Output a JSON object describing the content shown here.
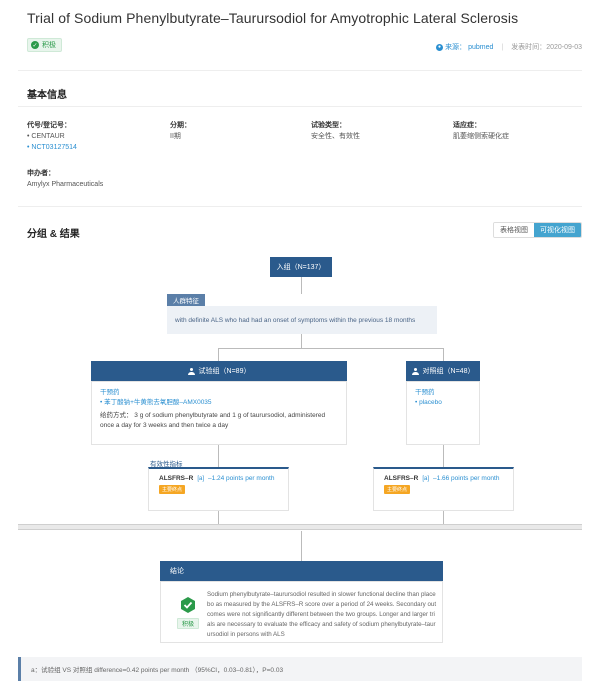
{
  "header": {
    "title": "Trial of Sodium Phenylbutyrate–Taurursodiol for Amyotrophic Lateral Sclerosis",
    "badge": "积极",
    "source_label": "来源：",
    "source_value": "pubmed",
    "publish_label": "发表时间：",
    "publish_date": "2020-09-03"
  },
  "basic_info": {
    "section_title": "基本信息",
    "code_label": "代号/登记号：",
    "code_values": [
      "CENTAUR",
      "NCT03127514"
    ],
    "phase_label": "分期：",
    "phase_value": "II期",
    "type_label": "试验类型：",
    "type_value": "安全性、有效性",
    "indication_label": "适应症：",
    "indication_value": "肌萎缩侧索硬化症",
    "sponsor_label": "申办者：",
    "sponsor_value": "Amylyx Pharmaceuticals"
  },
  "groups": {
    "section_title": "分组 & 结果",
    "view_table": "表格视图",
    "view_visual": "可视化视图",
    "enroll": "入组（N=137）",
    "population_label": "人群特征",
    "population_text": "with definite ALS who had had an onset of symptoms within the previous 18 months",
    "arm_treatment": {
      "title": "试验组（N=89）",
      "intervention_label": "干预药",
      "drug": "• 苯丁酸钠+牛黄熊去氧胆酸–AMX0035",
      "dosing": "给药方式： 3 g of sodium phenylbutyrate and 1 g of taurursodiol, administered once a day for 3 weeks and then twice a day"
    },
    "arm_control": {
      "title": "对照组（N=48）",
      "intervention_label": "干预药",
      "drug": "• placebo"
    },
    "outcome_label": "有效性指标",
    "outcome_treatment": {
      "name": "ALSFRS–R",
      "sup": "[a]",
      "value": "–1.24 points per month",
      "tag": "主要终点"
    },
    "outcome_control": {
      "name": "ALSFRS–R",
      "sup": "[a]",
      "value": "–1.66 points per month",
      "tag": "主要终点"
    }
  },
  "conclusion": {
    "title": "结论",
    "badge": "积极",
    "text": "Sodium phenylbutyrate–taurursodiol resulted in slower functional decline than placebo as measured by the ALSFRS–R score over a period of 24 weeks. Secondary outcomes were not significantly different between the two groups. Longer and larger trials are necessary to evaluate the efficacy and safety of sodium phenylbutyrate–taurursodiol in persons with ALS"
  },
  "footnote": "a：试验组 VS 对照组 difference=0.42 points per month （95%CI，0.03–0.81），P=0.03",
  "colors": {
    "primary": "#2a5a8c",
    "accent": "#2a8fd1",
    "positive": "#2b9a4a",
    "tag": "#f5a623"
  }
}
